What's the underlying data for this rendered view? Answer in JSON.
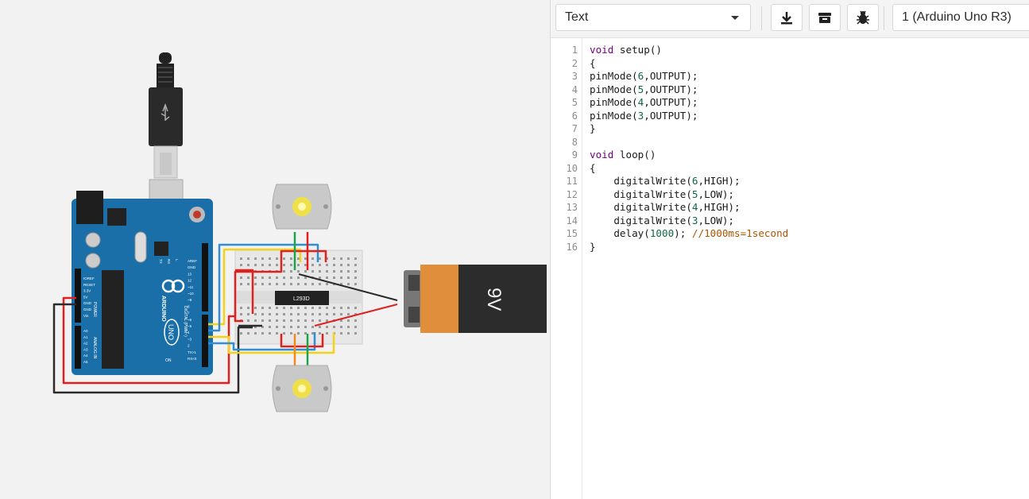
{
  "toolbar": {
    "mode_label": "Text",
    "download_icon": "download-icon",
    "library_icon": "library-icon",
    "debugger_icon": "bug-icon",
    "device_label": "1 (Arduino Uno R3)"
  },
  "editor": {
    "line_numbers": [
      "1",
      "2",
      "3",
      "4",
      "5",
      "6",
      "7",
      "8",
      "9",
      "10",
      "11",
      "12",
      "13",
      "14",
      "15",
      "16"
    ],
    "lines": [
      [
        {
          "t": "void",
          "c": "kw"
        },
        {
          "t": " setup()"
        }
      ],
      [
        {
          "t": "{"
        }
      ],
      [
        {
          "t": "pinMode("
        },
        {
          "t": "6",
          "c": "num"
        },
        {
          "t": ",OUTPUT);"
        }
      ],
      [
        {
          "t": "pinMode("
        },
        {
          "t": "5",
          "c": "num"
        },
        {
          "t": ",OUTPUT);"
        }
      ],
      [
        {
          "t": "pinMode("
        },
        {
          "t": "4",
          "c": "num"
        },
        {
          "t": ",OUTPUT);"
        }
      ],
      [
        {
          "t": "pinMode("
        },
        {
          "t": "3",
          "c": "num"
        },
        {
          "t": ",OUTPUT);"
        }
      ],
      [
        {
          "t": "}"
        }
      ],
      [
        {
          "t": ""
        }
      ],
      [
        {
          "t": "void",
          "c": "kw"
        },
        {
          "t": " loop()"
        }
      ],
      [
        {
          "t": "{"
        }
      ],
      [
        {
          "t": "    digitalWrite("
        },
        {
          "t": "6",
          "c": "num"
        },
        {
          "t": ",HIGH);"
        }
      ],
      [
        {
          "t": "    digitalWrite("
        },
        {
          "t": "5",
          "c": "num"
        },
        {
          "t": ",LOW);"
        }
      ],
      [
        {
          "t": "    digitalWrite("
        },
        {
          "t": "4",
          "c": "num"
        },
        {
          "t": ",HIGH);"
        }
      ],
      [
        {
          "t": "    digitalWrite("
        },
        {
          "t": "3",
          "c": "num"
        },
        {
          "t": ",LOW);"
        }
      ],
      [
        {
          "t": "    delay("
        },
        {
          "t": "1000",
          "c": "num"
        },
        {
          "t": "); "
        },
        {
          "t": "//1000ms=1second",
          "c": "cm"
        }
      ],
      [
        {
          "t": "}"
        }
      ]
    ]
  },
  "circuit": {
    "board_brand": "ARDUINO",
    "board_model": "UNO",
    "chip_label": "L293D",
    "battery_label": "9V",
    "power_header_title": "POWER",
    "power_pins": [
      "IOREF",
      "RESET",
      "3.3V",
      "5V",
      "GND",
      "GND",
      "Vin"
    ],
    "analog_header_title": "ANALOG IN",
    "analog_pins": [
      "A0",
      "A1",
      "A2",
      "A3",
      "A4",
      "A5"
    ],
    "digital_header_title": "DIGITAL (PWM~)",
    "digital_pins": [
      "AREF",
      "GND",
      "13",
      "12",
      "~11",
      "~10",
      "~9",
      "8",
      "7",
      "~6",
      "~5",
      "4",
      "~3",
      "2",
      "TX>1",
      "RX<0"
    ],
    "led_labels": [
      "TX",
      "RX",
      "L"
    ],
    "on_label": "ON"
  },
  "colors": {
    "board_blue": "#1a6fa8",
    "breadboard": "#e7e7e7",
    "wire_red": "#e0201f",
    "wire_black": "#2b2b2b",
    "wire_yellow": "#f3d21a",
    "wire_blue": "#2f8ed4",
    "wire_green": "#1fa24a",
    "wire_orange": "#f08a1c",
    "battery_orange": "#e08e3c",
    "battery_black": "#2c2c2c",
    "keyword": "#770088",
    "number": "#116644",
    "comment": "#aa5500"
  }
}
